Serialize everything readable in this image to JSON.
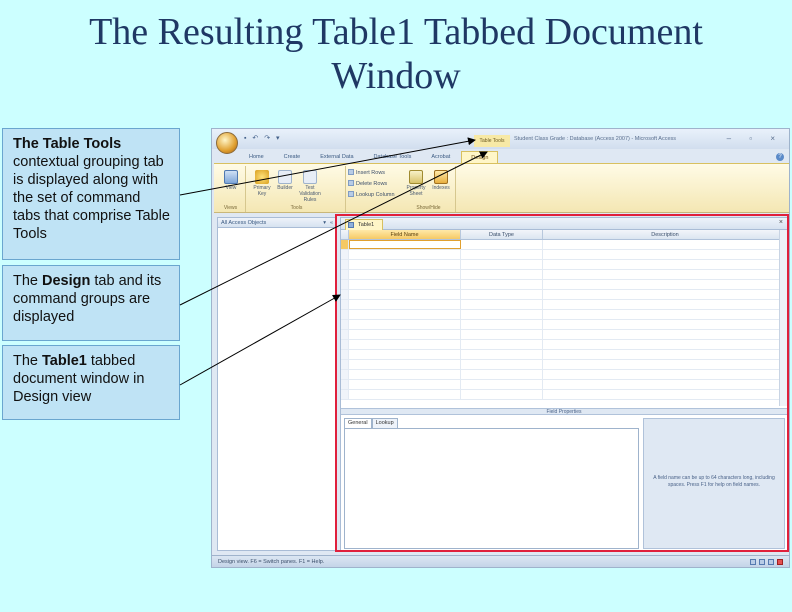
{
  "slide": {
    "title_line1": "The Resulting Table1 Tabbed Document",
    "title_line2": "Window"
  },
  "callouts": [
    {
      "bold": "The Table Tools",
      "text": " contextual grouping tab is displayed along with the set of command tabs that comprise Table Tools"
    },
    {
      "pre": "The ",
      "bold": "Design",
      "text": " tab and its command groups are displayed"
    },
    {
      "pre": "The ",
      "bold": "Table1",
      "text": " tabbed document window in Design view"
    }
  ],
  "app": {
    "context_group": "Table Tools",
    "title": "Student Class Grade : Database (Access 2007) - Microsoft Access",
    "window_controls": "– ▫ ×",
    "quick_access": "▪ ↶ ↷ ▾",
    "help": "?",
    "tabs": [
      "Home",
      "Create",
      "External Data",
      "Database Tools",
      "Acrobat",
      "Design"
    ],
    "ribbon": {
      "views_group": "Views",
      "view_btn": "View",
      "tools_group": "Tools",
      "primary_key": "Primary Key",
      "builder": "Builder",
      "test_rules": "Test Validation Rules",
      "insert_rows": "Insert Rows",
      "delete_rows": "Delete Rows",
      "lookup_column": "Lookup Column",
      "showhide_group": "Show/Hide",
      "property_sheet": "Property Sheet",
      "indexes": "Indexes"
    },
    "nav_pane": {
      "title": "All Access Objects",
      "dropdown": "▾",
      "shutter": "«"
    },
    "doc_tab": "Table1",
    "doc_close": "×",
    "grid_headers": {
      "field_name": "Field Name",
      "data_type": "Data Type",
      "description": "Description"
    },
    "field_properties": "Field Properties",
    "fp_tabs": [
      "General",
      "Lookup"
    ],
    "help_text": "A field name can be up to 64 characters long, including spaces. Press F1 for help on field names.",
    "status": "Design view.  F6 = Switch panes.  F1 = Help."
  },
  "colors": {
    "slide_bg": "#ccffff",
    "title": "#1f3864",
    "highlight": "#e0203c",
    "callout_bg": "#bfe3f5"
  }
}
